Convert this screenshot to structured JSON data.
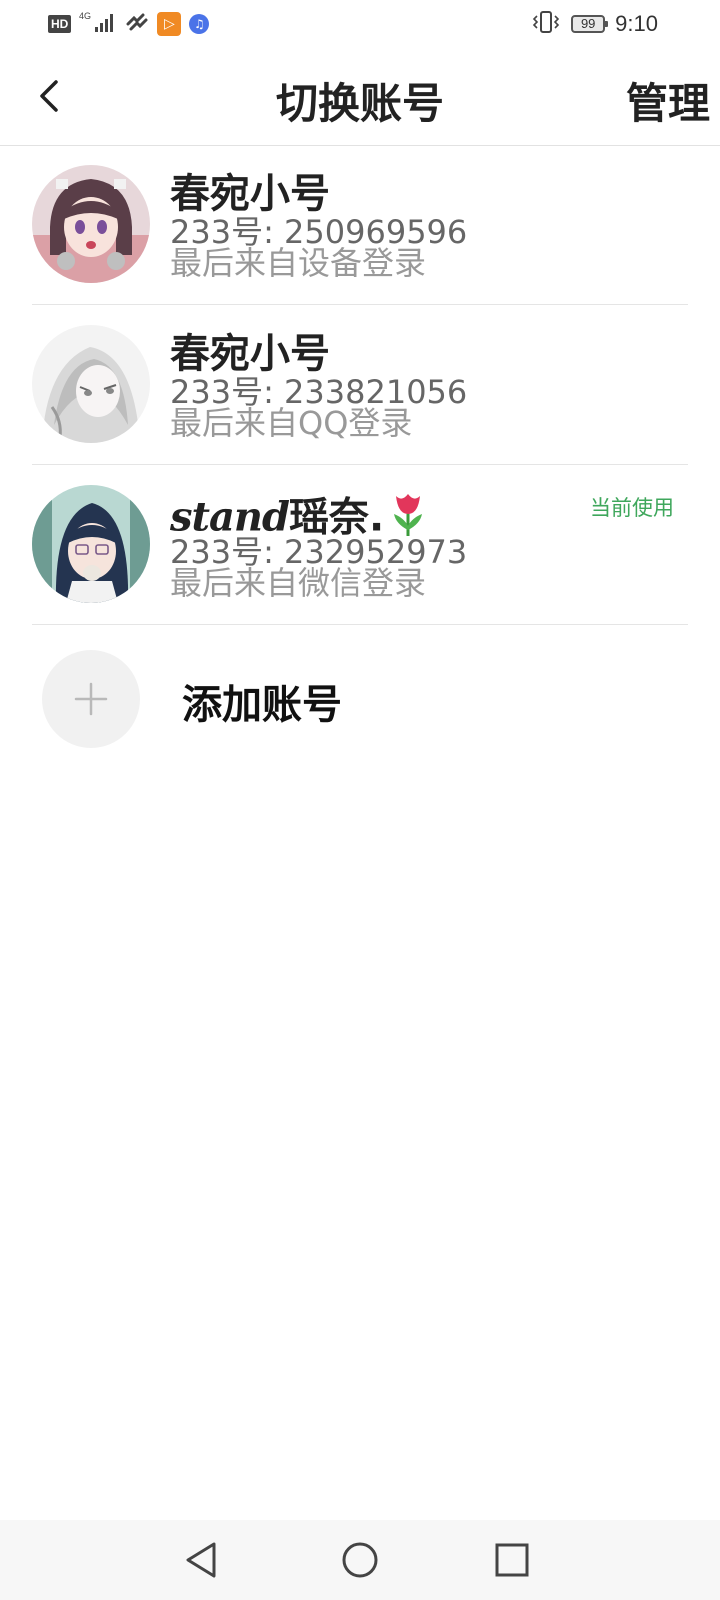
{
  "status_bar": {
    "hd": "HD",
    "network": "4G",
    "time": "9:10",
    "battery": "99"
  },
  "header": {
    "title": "切换账号",
    "manage_label": "管理",
    "back_icon": "chevron-left-icon"
  },
  "accounts": [
    {
      "name": "春宛小号",
      "id_text": "233号: 250969596",
      "source": "最后来自设备登录",
      "current": false
    },
    {
      "name": "春宛小号",
      "id_text": "233号: 233821056",
      "source": "最后来自QQ登录",
      "current": false
    },
    {
      "name_script": "stand",
      "name_main": "瑶奈.",
      "name_emoji": "🌷",
      "id_text": "233号: 232952973",
      "source": "最后来自微信登录",
      "current": true,
      "current_label": "当前使用"
    }
  ],
  "add_account": {
    "label": "添加账号",
    "icon": "plus-icon"
  },
  "nav_bar": {
    "back_icon": "triangle-back-icon",
    "home_icon": "circle-home-icon",
    "recents_icon": "square-recents-icon"
  },
  "colors": {
    "current_badge": "#3fa75c",
    "title": "#222222",
    "id_text": "#666666",
    "source_text": "#999999"
  }
}
